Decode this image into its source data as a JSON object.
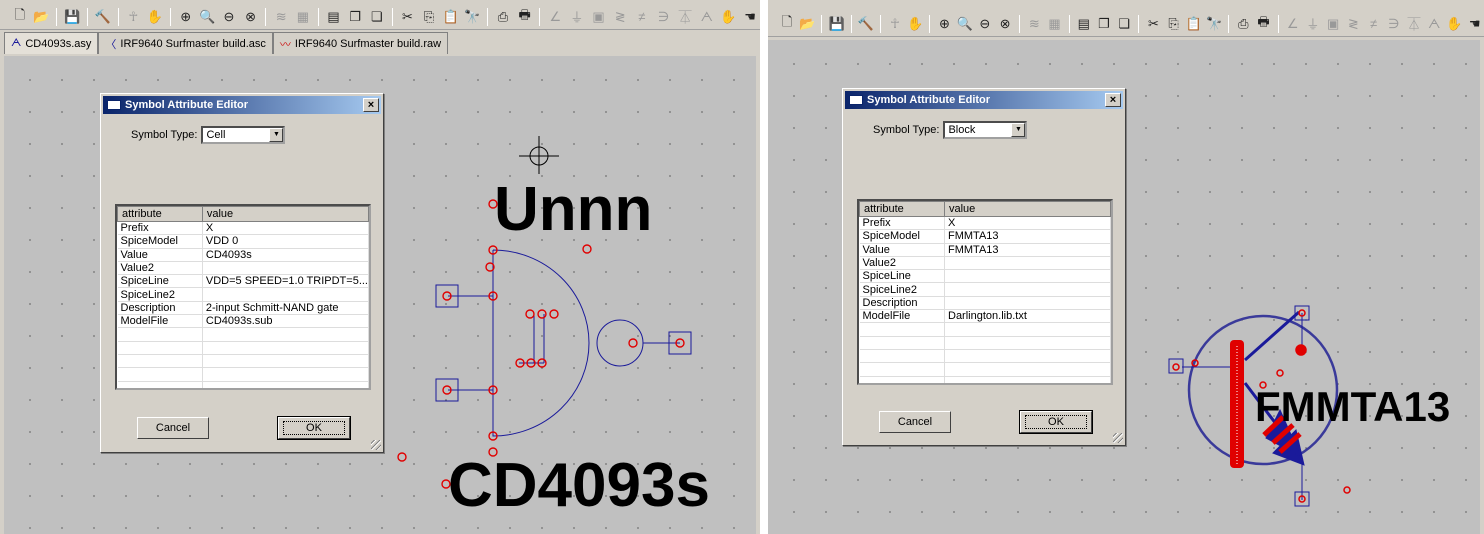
{
  "toolbar_icons": [
    {
      "name": "new-schematic-icon",
      "g": "🗋"
    },
    {
      "name": "open-icon",
      "g": "📂"
    },
    {
      "sep": true
    },
    {
      "name": "save-icon",
      "g": "💾"
    },
    {
      "sep": true
    },
    {
      "name": "control-panel-hammer-icon",
      "g": "🔨"
    },
    {
      "sep": true
    },
    {
      "name": "run-icon",
      "g": "☥",
      "dis": true
    },
    {
      "name": "halt-hand-icon",
      "g": "✋",
      "dis": true
    },
    {
      "sep": true
    },
    {
      "name": "zoom-in-icon",
      "g": "⊕"
    },
    {
      "name": "zoom-pan-icon",
      "g": "🔍"
    },
    {
      "name": "zoom-out-icon",
      "g": "⊖"
    },
    {
      "name": "zoom-fit-icon",
      "g": "⊗"
    },
    {
      "sep": true
    },
    {
      "name": "autorange-icon",
      "g": "≋",
      "dis": true
    },
    {
      "name": "grid-icon",
      "g": "▦",
      "dis": true
    },
    {
      "sep": true
    },
    {
      "name": "tile-horizontal-icon",
      "g": "▤"
    },
    {
      "name": "cascade-icon",
      "g": "❐"
    },
    {
      "name": "close-windows-icon",
      "g": "❏"
    },
    {
      "sep": true
    },
    {
      "name": "cut-icon",
      "g": "✂"
    },
    {
      "name": "copy-icon",
      "g": "⎘"
    },
    {
      "name": "paste-icon",
      "g": "📋"
    },
    {
      "name": "find-icon",
      "g": "🔭"
    },
    {
      "sep": true
    },
    {
      "name": "print-preview-icon",
      "g": "⎙"
    },
    {
      "name": "print-icon",
      "g": "🖶"
    },
    {
      "sep": true
    },
    {
      "name": "wire-icon",
      "g": "∠",
      "dis": true
    },
    {
      "name": "ground-icon",
      "g": "⏚",
      "dis": true
    },
    {
      "name": "label-icon",
      "g": "▣",
      "dis": true
    },
    {
      "name": "resistor-icon",
      "g": "≷",
      "dis": true
    },
    {
      "name": "capacitor-icon",
      "g": "≠",
      "dis": true
    },
    {
      "name": "inductor-icon",
      "g": "∋",
      "dis": true
    },
    {
      "name": "diode-icon",
      "g": "⏄",
      "dis": true
    },
    {
      "name": "component-icon",
      "g": "ᗅ",
      "dis": true
    },
    {
      "name": "move-hand-icon",
      "g": "✋"
    },
    {
      "name": "drag-hand-icon",
      "g": "☚"
    }
  ],
  "left": {
    "tabs": [
      {
        "icon": "symbol-icon",
        "g": "ᗅ",
        "label": "CD4093s.asy"
      },
      {
        "icon": "schematic-icon",
        "g": "〈",
        "label": "IRF9640 Surfmaster build.asc"
      },
      {
        "icon": "waveform-icon",
        "g": "〰",
        "label": "IRF9640 Surfmaster build.raw"
      }
    ],
    "dialog": {
      "title": "Symbol Attribute Editor",
      "symbol_type_label": "Symbol Type:",
      "symbol_type": "Cell",
      "columns": [
        "attribute",
        "value"
      ],
      "rows": [
        [
          "Prefix",
          "X"
        ],
        [
          "SpiceModel",
          "VDD 0"
        ],
        [
          "Value",
          "CD4093s"
        ],
        [
          "Value2",
          ""
        ],
        [
          "SpiceLine",
          "VDD=5  SPEED=1.0  TRIPDT=5..."
        ],
        [
          "SpiceLine2",
          ""
        ],
        [
          "Description",
          "2-input Schmitt-NAND gate"
        ],
        [
          "ModelFile",
          "CD4093s.sub"
        ],
        [
          "",
          ""
        ],
        [
          "",
          ""
        ],
        [
          "",
          ""
        ],
        [
          "",
          ""
        ],
        [
          "",
          ""
        ]
      ],
      "cancel": "Cancel",
      "ok": "OK",
      "close": "×"
    },
    "labels": {
      "instname": "Unnn",
      "value": "CD4093s"
    }
  },
  "right": {
    "dialog": {
      "title": "Symbol Attribute Editor",
      "symbol_type_label": "Symbol Type:",
      "symbol_type": "Block",
      "columns": [
        "attribute",
        "value"
      ],
      "rows": [
        [
          "Prefix",
          "X"
        ],
        [
          "SpiceModel",
          "FMMTA13"
        ],
        [
          "Value",
          "FMMTA13"
        ],
        [
          "Value2",
          ""
        ],
        [
          "SpiceLine",
          ""
        ],
        [
          "SpiceLine2",
          ""
        ],
        [
          "Description",
          ""
        ],
        [
          "ModelFile",
          "Darlington.lib.txt"
        ],
        [
          "",
          ""
        ],
        [
          "",
          ""
        ],
        [
          "",
          ""
        ],
        [
          "",
          ""
        ],
        [
          "",
          ""
        ]
      ],
      "cancel": "Cancel",
      "ok": "OK",
      "close": "×"
    },
    "labels": {
      "value": "FMMTA13"
    }
  },
  "colors": {
    "wire": "#1a1a9a",
    "pin": "#e00000",
    "canvas": "#c0c0c0",
    "titlebar": "#0a246a"
  }
}
